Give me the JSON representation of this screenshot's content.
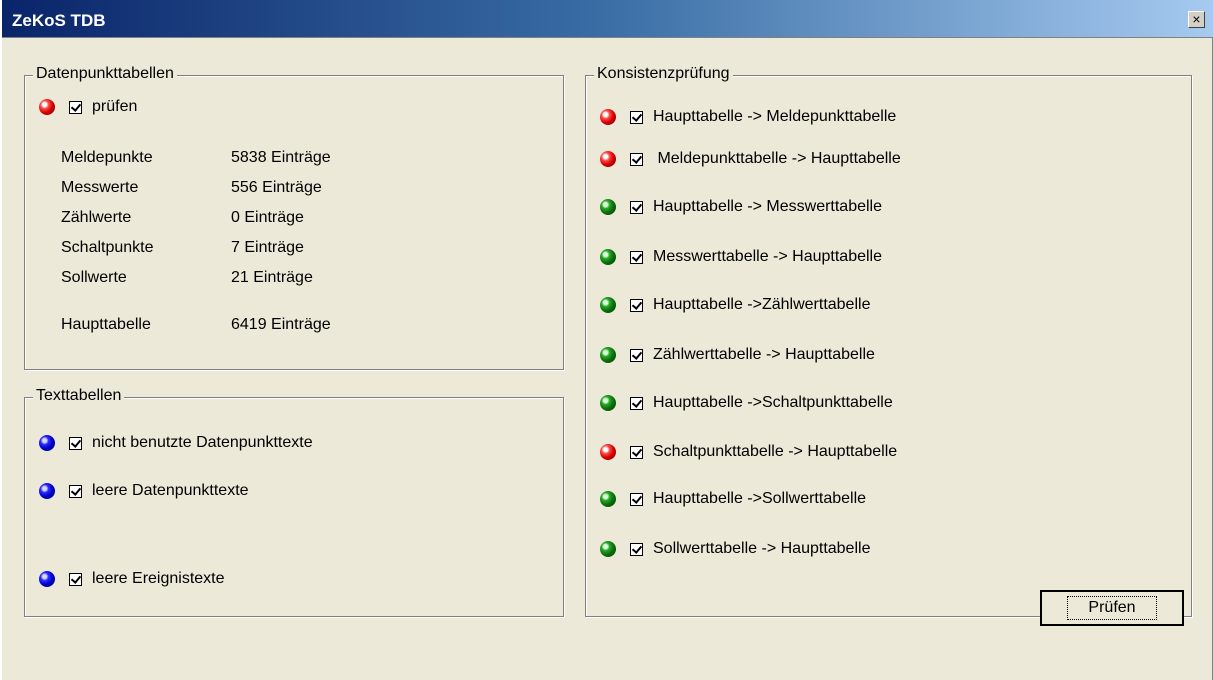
{
  "window": {
    "title": "ZeKoS TDB",
    "close_glyph": "×"
  },
  "datenpunkt": {
    "legend": "Datenpunkttabellen",
    "check_label": "prüfen",
    "status": "red",
    "rows": [
      {
        "label": "Meldepunkte",
        "value": "5838 Einträge"
      },
      {
        "label": "Messwerte",
        "value": "556 Einträge"
      },
      {
        "label": "Zählwerte",
        "value": "0 Einträge"
      },
      {
        "label": "Schaltpunkte",
        "value": "7 Einträge"
      },
      {
        "label": "Sollwerte",
        "value": "21 Einträge"
      },
      {
        "label": "Haupttabelle",
        "value": "6419 Einträge"
      }
    ]
  },
  "text": {
    "legend": "Texttabellen",
    "items": [
      {
        "label": "nicht benutzte Datenpunkttexte",
        "status": "blue"
      },
      {
        "label": "leere Datenpunkttexte",
        "status": "blue"
      },
      {
        "label": "leere Ereignistexte",
        "status": "blue"
      }
    ]
  },
  "konsistenz": {
    "legend": "Konsistenzprüfung",
    "items": [
      {
        "label": "Haupttabelle -> Meldepunkttabelle",
        "status": "red"
      },
      {
        "label": " Meldepunkttabelle -> Haupttabelle",
        "status": "red"
      },
      {
        "label": "Haupttabelle -> Messwerttabelle",
        "status": "green"
      },
      {
        "label": "Messwerttabelle -> Haupttabelle",
        "status": "green"
      },
      {
        "label": "Haupttabelle ->Zählwerttabelle",
        "status": "green"
      },
      {
        "label": "Zählwerttabelle -> Haupttabelle",
        "status": "green"
      },
      {
        "label": "Haupttabelle ->Schaltpunkttabelle",
        "status": "green"
      },
      {
        "label": "Schaltpunkttabelle -> Haupttabelle",
        "status": "red"
      },
      {
        "label": "Haupttabelle ->Sollwerttabelle",
        "status": "green"
      },
      {
        "label": "Sollwerttabelle -> Haupttabelle",
        "status": "green"
      }
    ]
  },
  "actions": {
    "pruefen_label": "Prüfen"
  }
}
